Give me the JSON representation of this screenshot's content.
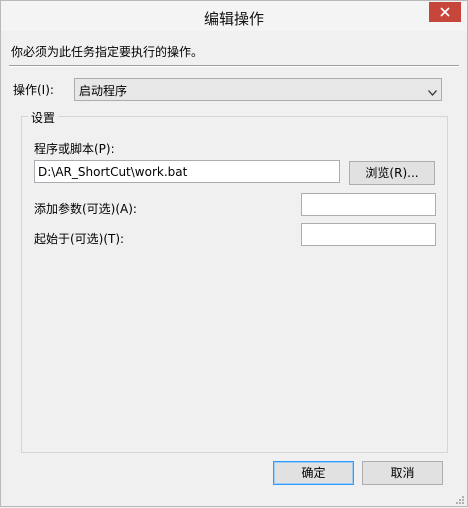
{
  "window": {
    "title": "编辑操作"
  },
  "instruction": "你必须为此任务指定要执行的操作。",
  "action": {
    "label": "操作(I):",
    "value": "启动程序"
  },
  "settings": {
    "group_title": "设置",
    "program_label": "程序或脚本(P):",
    "program_value": "D:\\AR_ShortCut\\work.bat",
    "browse_label": "浏览(R)...",
    "args_label": "添加参数(可选)(A):",
    "args_value": "",
    "startin_label": "起始于(可选)(T):",
    "startin_value": ""
  },
  "buttons": {
    "ok": "确定",
    "cancel": "取消"
  },
  "icons": {
    "close": "close-icon",
    "dropdown": "chevron-down-icon",
    "grip": "resize-grip-icon"
  },
  "colors": {
    "close_bg": "#c7463b",
    "default_button_border": "#3399ff"
  }
}
